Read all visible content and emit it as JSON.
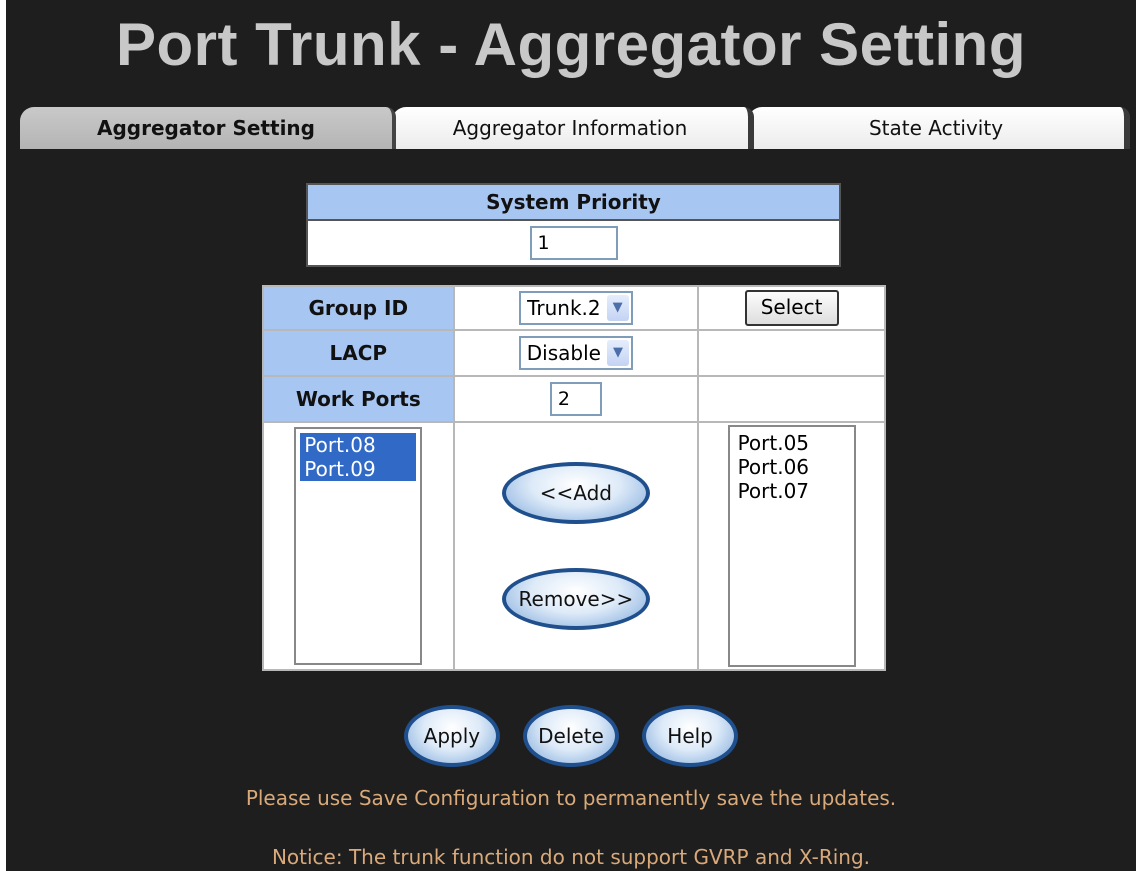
{
  "page": {
    "title": "Port Trunk - Aggregator Setting"
  },
  "tabs": [
    {
      "label": "Aggregator Setting"
    },
    {
      "label": "Aggregator Information"
    },
    {
      "label": "State Activity"
    }
  ],
  "system_priority": {
    "header": "System Priority",
    "value": "1"
  },
  "group": {
    "group_id_label": "Group ID",
    "group_id_value": "Trunk.2",
    "select_button": "Select",
    "lacp_label": "LACP",
    "lacp_value": "Disable",
    "work_ports_label": "Work Ports",
    "work_ports_value": "2"
  },
  "lists": {
    "trunk_members": [
      "Port.08",
      "Port.09"
    ],
    "available_ports": [
      "Port.05",
      "Port.06",
      "Port.07"
    ],
    "add_button": "<<Add",
    "remove_button": "Remove>>"
  },
  "actions": {
    "apply": "Apply",
    "delete": "Delete",
    "help": "Help"
  },
  "messages": {
    "save_hint": "Please use Save Configuration to permanently save the updates.",
    "notice": "Notice: The trunk function do not support GVRP and X-Ring."
  },
  "colors": {
    "background": "#1e1e1e",
    "header_blue": "#a8c6f2",
    "selection_blue": "#3169c6",
    "message_text": "#d9a97a"
  },
  "icons": {
    "dropdown": "chevron-down-icon"
  }
}
